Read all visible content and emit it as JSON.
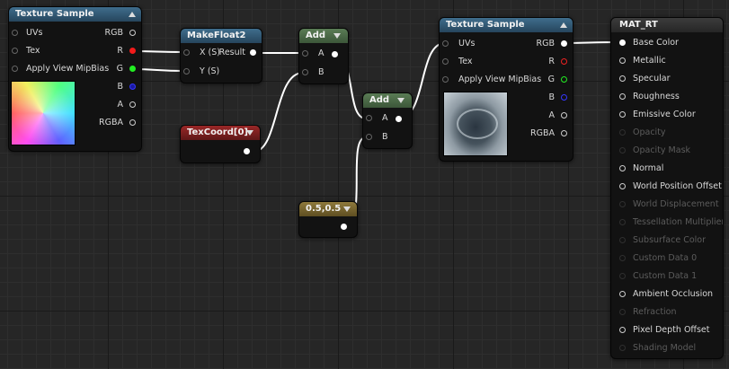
{
  "nodes": {
    "tex1": {
      "title": "Texture Sample",
      "inputs": [
        "UVs",
        "Tex",
        "Apply View MipBias"
      ],
      "outputs": [
        "RGB",
        "R",
        "G",
        "B",
        "A",
        "RGBA"
      ]
    },
    "makefloat2": {
      "title": "MakeFloat2",
      "inputs": [
        "X (S)",
        "Y (S)"
      ],
      "output": "Result"
    },
    "add1": {
      "title": "Add",
      "inputs": [
        "A",
        "B"
      ]
    },
    "texcoord": {
      "title": "TexCoord[0]"
    },
    "add2": {
      "title": "Add",
      "inputs": [
        "A",
        "B"
      ]
    },
    "const": {
      "title": "0.5,0.5"
    },
    "tex2": {
      "title": "Texture Sample",
      "inputs": [
        "UVs",
        "Tex",
        "Apply View MipBias"
      ],
      "outputs": [
        "RGB",
        "R",
        "G",
        "B",
        "A",
        "RGBA"
      ]
    },
    "mat": {
      "title": "MAT_RT",
      "inputs": [
        {
          "label": "Base Color",
          "enabled": true
        },
        {
          "label": "Metallic",
          "enabled": true
        },
        {
          "label": "Specular",
          "enabled": true
        },
        {
          "label": "Roughness",
          "enabled": true
        },
        {
          "label": "Emissive Color",
          "enabled": true
        },
        {
          "label": "Opacity",
          "enabled": false
        },
        {
          "label": "Opacity Mask",
          "enabled": false
        },
        {
          "label": "Normal",
          "enabled": true
        },
        {
          "label": "World Position Offset",
          "enabled": true
        },
        {
          "label": "World Displacement",
          "enabled": false
        },
        {
          "label": "Tessellation Multiplier",
          "enabled": false
        },
        {
          "label": "Subsurface Color",
          "enabled": false
        },
        {
          "label": "Custom Data 0",
          "enabled": false
        },
        {
          "label": "Custom Data 1",
          "enabled": false
        },
        {
          "label": "Ambient Occlusion",
          "enabled": true
        },
        {
          "label": "Refraction",
          "enabled": false
        },
        {
          "label": "Pixel Depth Offset",
          "enabled": true
        },
        {
          "label": "Shading Model",
          "enabled": false
        }
      ]
    }
  },
  "colors": {
    "texture_header": "#3f6d8c",
    "math_header": "#5a7c55",
    "coord_header": "#9a2727",
    "constant_header": "#8f7a3c",
    "result_header": "#3c3c3c",
    "wire": "#ffffff"
  }
}
